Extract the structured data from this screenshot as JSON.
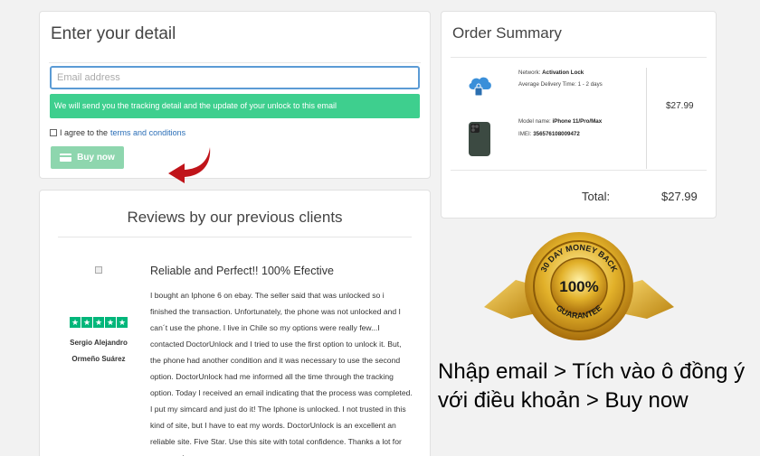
{
  "detail": {
    "title": "Enter your detail",
    "email_placeholder": "Email address",
    "notice": "We will send you the tracking detail and the update of your unlock to this email",
    "agree_prefix": "I agree to the",
    "terms_link": "terms and conditions",
    "buy_now_label": "Buy now"
  },
  "reviews": {
    "title": "Reviews by our previous clients",
    "review_title": "Reliable and Perfect!! 100% Efective",
    "reviewer_line1": "Sergio Alejandro",
    "reviewer_line2": "Ormeño Suárez",
    "rating": 5,
    "body": "I bought an Iphone 6 on ebay. The seller said that was unlocked so i finished the transaction. Unfortunately, the phone was not unlocked and I can´t use the phone. I live in Chile so my options were really few...I contacted DoctorUnlock and I tried to use the first option to unlock it. But, the phone had another condition and it was necessary to use the second option. DoctorUnlock had me informed all the time through the tracking option. Today I received an email indicating that the process was completed. I put my simcard and just do it! The Iphone is unlocked. I not trusted in this kind of site, but I have to eat my words. DoctorUnlock is an excellent an reliable site. Five Star. Use this site with total confidence. Thanks a lot for your service."
  },
  "order": {
    "title": "Order Summary",
    "network_label": "Network:",
    "network_value": "Activation Lock",
    "delivery_label": "Average Delivery Time:",
    "delivery_value": "1 - 2 days",
    "model_label": "Model name:",
    "model_value": "iPhone 11/Pro/Max",
    "imei_label": "IMEI:",
    "imei_value": "356576108009472",
    "item_price": "$27.99",
    "total_label": "Total:",
    "total_value": "$27.99"
  },
  "badge": {
    "top_text": "30 DAY MONEY BACK",
    "center_text": "100%",
    "bottom_text": "GUARANTEE"
  },
  "instruction": "Nhập email > Tích vào ô đồng ý với điều khoản > Buy now",
  "colors": {
    "notice_bg": "#3ecf8e",
    "button_bg": "#8ed6ae",
    "link": "#2a6eb7",
    "star": "#00b67a",
    "arrow": "#c0141a",
    "gold": "#d9a520"
  }
}
